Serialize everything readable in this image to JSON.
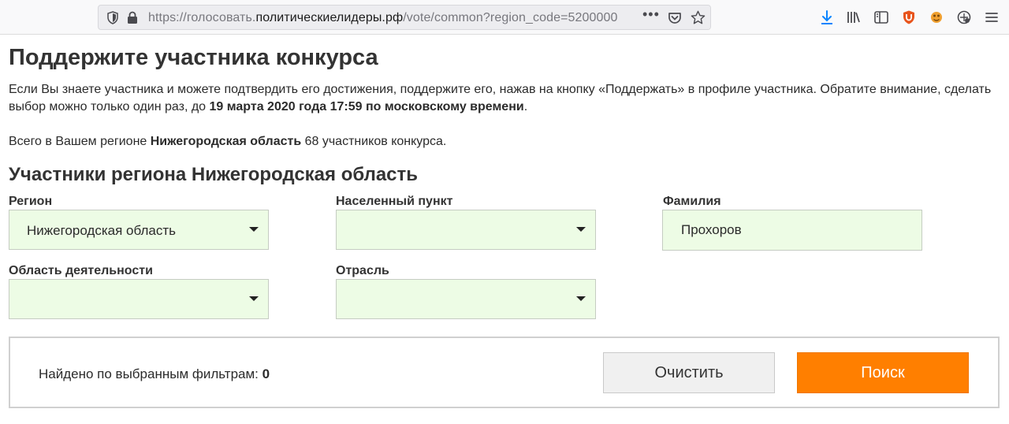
{
  "browser": {
    "url_prefix": "https://голосовать.",
    "url_host": "политическиелидеры.рф",
    "url_path": "/vote/common?region_code=5200000",
    "more_glyph": "•••",
    "icons": [
      "shield-icon",
      "lock-icon",
      "pocket-icon",
      "bookmark-star-icon",
      "download-icon",
      "library-icon",
      "sidebar-icon",
      "ublock-icon",
      "extension-icon",
      "extension-icon-2",
      "menu-icon"
    ]
  },
  "page": {
    "title": "Поддержите участника конкурса",
    "intro_text_1": "Если Вы знаете участника и можете подтвердить его достижения, поддержите его, нажав на кнопку «Поддержать» в профиле участника. Обратите внимание, сделать выбор можно только один раз, до ",
    "intro_deadline": "19 марта 2020 года 17:59 по московскому времени",
    "intro_text_2": ".",
    "count_prefix": "Всего в Вашем регионе ",
    "count_region": "Нижегородская область",
    "count_suffix": " 68 участников конкурса.",
    "section_title": "Участники региона Нижегородская область"
  },
  "filters": {
    "region": {
      "label": "Регион",
      "value": "Нижегородская область"
    },
    "locality": {
      "label": "Населенный пункт",
      "value": ""
    },
    "surname": {
      "label": "Фамилия",
      "value": "Прохоров"
    },
    "activity_area": {
      "label": "Область деятельности",
      "value": ""
    },
    "industry": {
      "label": "Отрасль",
      "value": ""
    }
  },
  "results": {
    "found_label": "Найдено по выбранным фильтрам: ",
    "found_count": "0",
    "clear_button": "Очистить",
    "search_button": "Поиск"
  },
  "colors": {
    "field_bg": "#edfce5",
    "search_button": "#ff7f00",
    "clear_button": "#f0f0f0"
  }
}
